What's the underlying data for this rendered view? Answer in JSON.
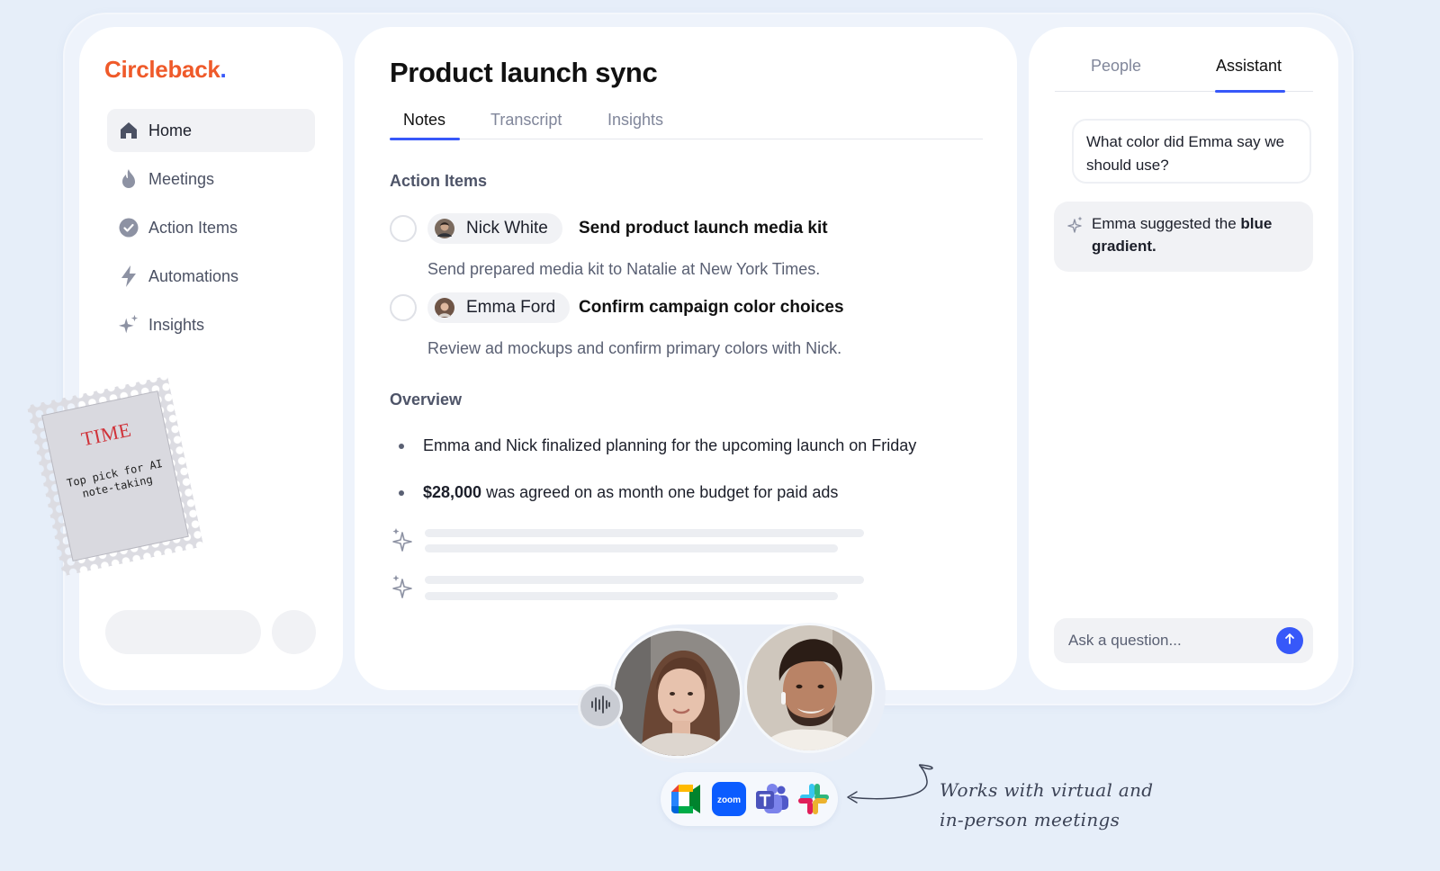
{
  "brand": {
    "name": "Circleback",
    "dot": ".",
    "name_color": "#ef5a2a",
    "accent": "#3758f9"
  },
  "sidebar": {
    "items": [
      {
        "label": "Home",
        "icon": "home-icon",
        "active": true
      },
      {
        "label": "Meetings",
        "icon": "flame-icon"
      },
      {
        "label": "Action Items",
        "icon": "check-circle-icon"
      },
      {
        "label": "Automations",
        "icon": "lightning-icon"
      },
      {
        "label": "Insights",
        "icon": "sparkle-icon"
      }
    ]
  },
  "stamp": {
    "title": "TIME",
    "text_line1": "Top pick for AI",
    "text_line2": "note-taking"
  },
  "meeting": {
    "title": "Product launch sync",
    "tabs": [
      {
        "label": "Notes",
        "active": true
      },
      {
        "label": "Transcript"
      },
      {
        "label": "Insights"
      }
    ],
    "action_items_heading": "Action Items",
    "action_items": [
      {
        "assignee": "Nick White",
        "title": "Send product launch media kit",
        "description": "Send prepared media kit to Natalie at New York Times."
      },
      {
        "assignee": "Emma Ford",
        "title": "Confirm campaign color choices",
        "description": "Review ad mockups and confirm primary colors with Nick."
      }
    ],
    "overview_heading": "Overview",
    "overview": [
      {
        "bold": "",
        "text": "Emma and Nick finalized  planning for the upcoming launch on Friday"
      },
      {
        "bold": "$28,000",
        "text": " was agreed on as month one budget for paid ads"
      }
    ]
  },
  "assistant": {
    "tabs": [
      {
        "label": "People"
      },
      {
        "label": "Assistant",
        "active": true
      }
    ],
    "question": "What color did Emma say we should use?",
    "answer_prefix": "Emma suggested the ",
    "answer_bold": "blue gradient.",
    "input_placeholder": "Ask a question..."
  },
  "integrations": {
    "apps": [
      {
        "name": "Google Meet",
        "icon": "google-meet-icon"
      },
      {
        "name": "zoom",
        "icon": "zoom-icon"
      },
      {
        "name": "Microsoft Teams",
        "icon": "teams-icon"
      },
      {
        "name": "Slack",
        "icon": "slack-icon"
      }
    ],
    "note_line1": "Works with virtual and",
    "note_line2": "in-person meetings"
  }
}
